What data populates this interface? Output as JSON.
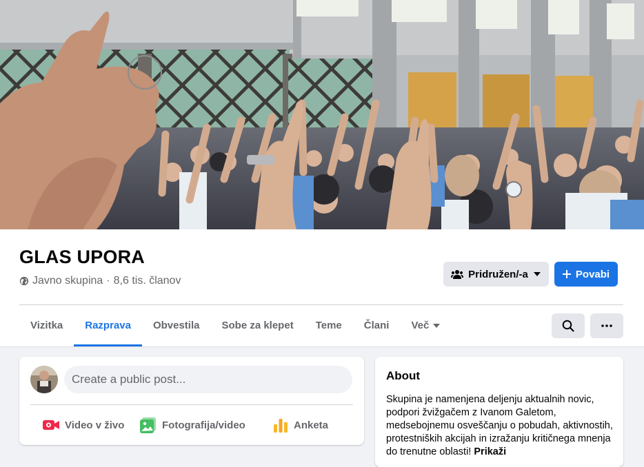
{
  "group": {
    "name": "GLAS UPORA",
    "privacy": "Javno skupina",
    "separator": "·",
    "members": "8,6 tis. članov"
  },
  "actions": {
    "joined_label": "Pridružen/-a",
    "invite_label": "Povabi"
  },
  "tabs": [
    {
      "label": "Vizitka"
    },
    {
      "label": "Razprava",
      "active": true
    },
    {
      "label": "Obvestila"
    },
    {
      "label": "Sobe za klepet"
    },
    {
      "label": "Teme"
    },
    {
      "label": "Člani"
    },
    {
      "label": "Več"
    }
  ],
  "icons": {
    "search": "search-icon",
    "more": "more-horizontal-icon",
    "globe": "globe-icon",
    "members": "people-icon",
    "plus": "plus-icon",
    "caret": "caret-down-icon"
  },
  "composer": {
    "placeholder": "Create a public post...",
    "actions": [
      {
        "label": "Video v živo",
        "icon": "live-video-icon",
        "color": "#f02849"
      },
      {
        "label": "Fotografija/video",
        "icon": "photo-icon",
        "color": "#45bd62"
      },
      {
        "label": "Anketa",
        "icon": "poll-icon",
        "color": "#f7b928"
      }
    ]
  },
  "about": {
    "title": "About",
    "text": "Skupina je namenjena deljenju aktualnih novic, podpori žvižgačem z Ivanom Galetom, medsebojnemu osveščanju o pobudah, aktivnostih, protestniških akcijah in izražanju kritičnega mnenja do trenutne oblasti!",
    "more": "Prikaži"
  },
  "colors": {
    "accent": "#1b74e4",
    "secondary_text": "#65676b",
    "background": "#f0f2f5"
  }
}
